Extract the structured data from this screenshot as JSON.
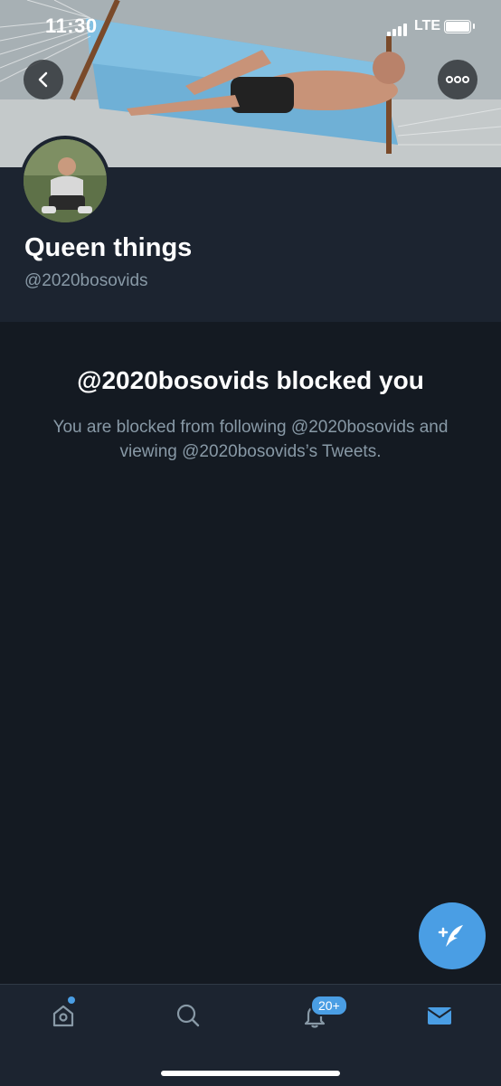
{
  "status_bar": {
    "time": "11:30",
    "network": "LTE"
  },
  "profile": {
    "display_name": "Queen things",
    "handle": "@2020bosovids"
  },
  "blocked": {
    "title": "@2020bosovids blocked you",
    "description": "You are blocked from following @2020bosovids and viewing @2020bosovids’s Tweets."
  },
  "tab_bar": {
    "notifications_badge": "20+",
    "active_tab": "messages"
  },
  "icons": {
    "back": "chevron-left-icon",
    "more": "more-horizontal-icon",
    "compose": "compose-tweet-icon",
    "home": "home-icon",
    "search": "search-icon",
    "notifications": "bell-icon",
    "messages": "mail-icon"
  },
  "colors": {
    "background": "#141a22",
    "header": "#1c2430",
    "accent": "#4a9ee4",
    "muted_text": "#8899a6"
  }
}
